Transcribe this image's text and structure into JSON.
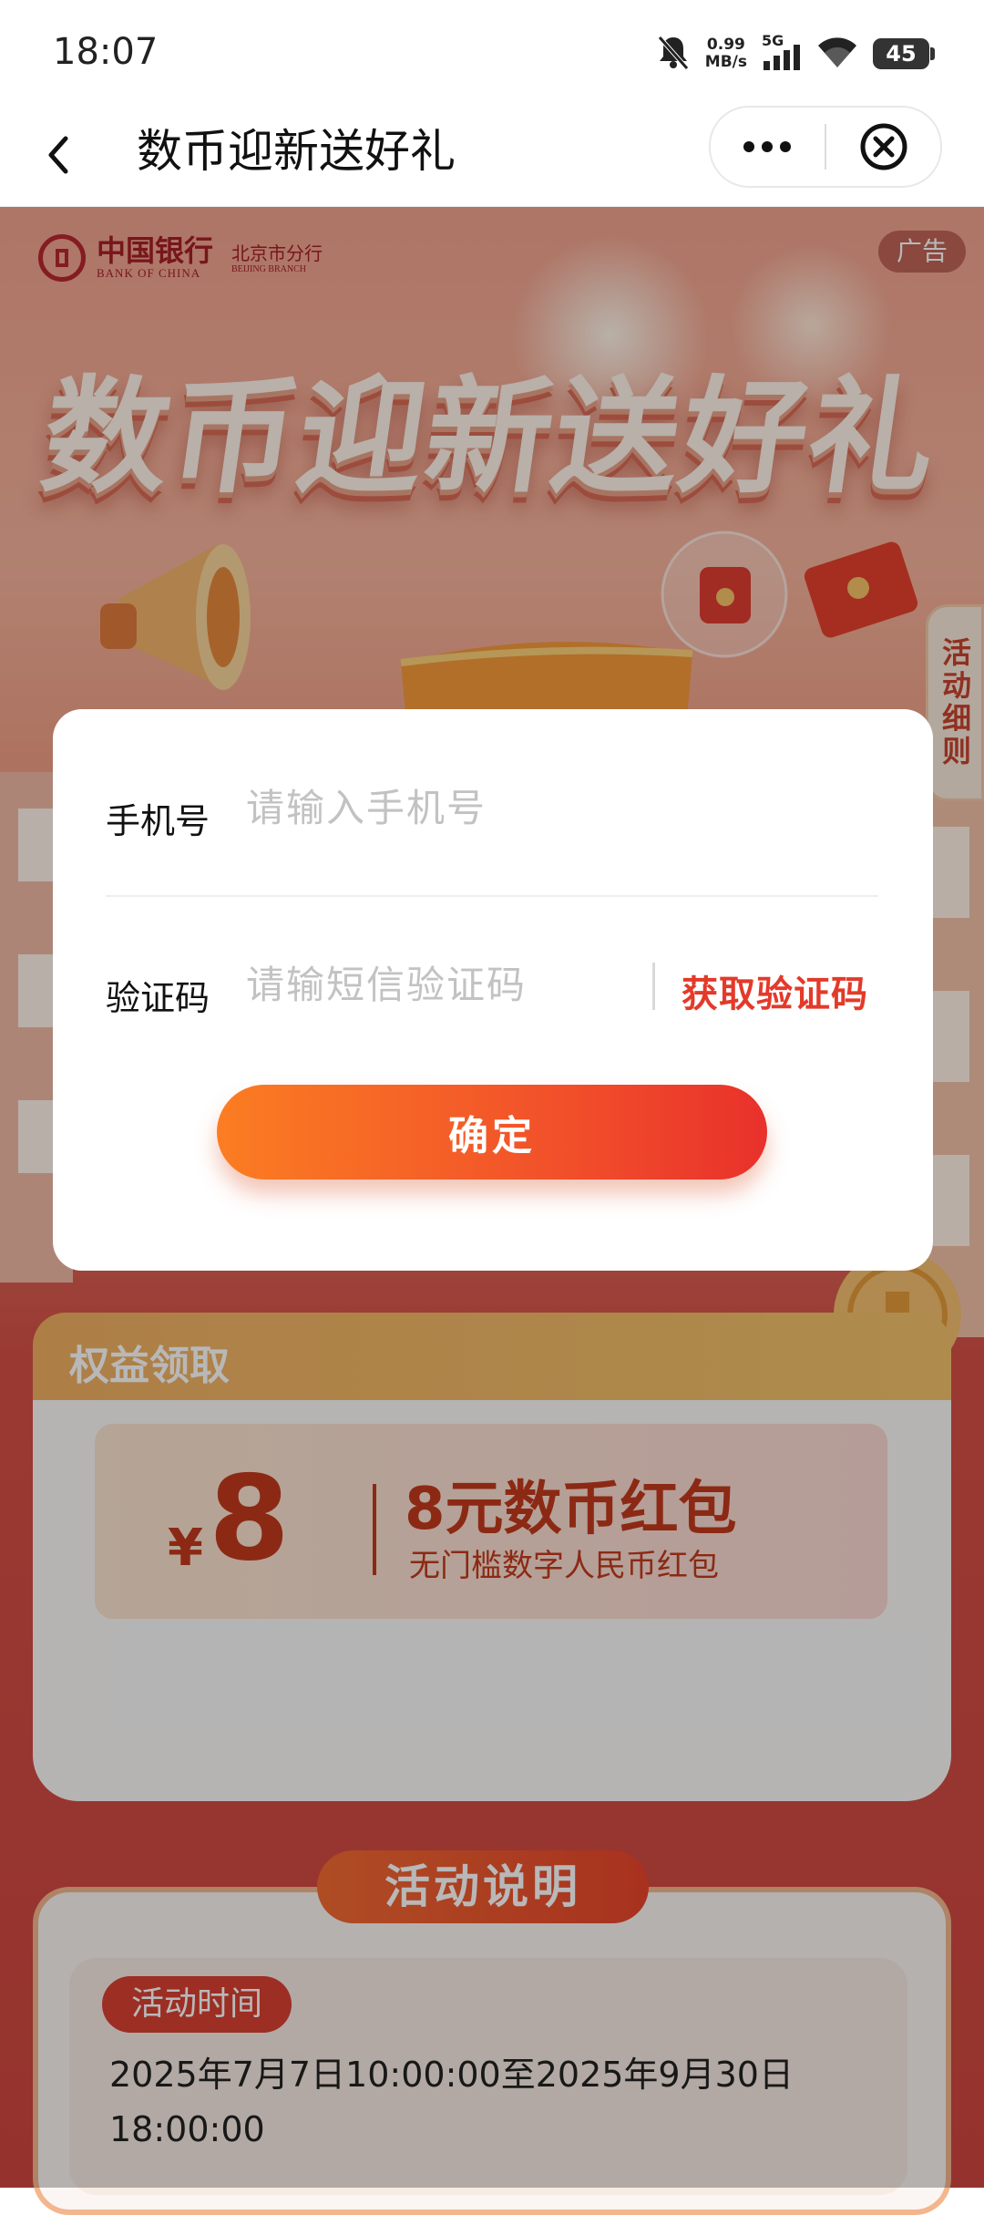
{
  "status_bar": {
    "time": "18:07",
    "net_speed_value": "0.99",
    "net_speed_unit": "MB/s",
    "network": "5G",
    "battery": "45",
    "icons": [
      "mute-bell-icon",
      "signal-icon",
      "wifi-icon",
      "battery-icon"
    ]
  },
  "nav": {
    "title": "数币迎新送好礼",
    "back_icon": "back-chevron-icon",
    "more_icon": "more-dots-icon",
    "close_icon": "close-circle-icon"
  },
  "banner": {
    "bank_name_cn": "中国银行",
    "bank_name_en": "BANK OF CHINA",
    "branch_cn": "北京市分行",
    "branch_en": "BEIJING BRANCH",
    "ad_label": "广告",
    "hero_title": "数币迎新送好礼",
    "side_tab": "活动细则"
  },
  "modal": {
    "phone_label": "手机号",
    "phone_placeholder": "请输入手机号",
    "phone_value": "",
    "code_label": "验证码",
    "code_placeholder": "请输短信验证码",
    "code_value": "",
    "get_code_label": "获取验证码",
    "confirm_label": "确定"
  },
  "benefits": {
    "title": "权益领取",
    "coupon": {
      "currency": "¥",
      "amount": "8",
      "title": "8元数币红包",
      "subtitle": "无门槛数字人民币红包"
    }
  },
  "activity": {
    "title": "活动说明",
    "time_badge": "活动时间",
    "time_text": "2025年7月7日10:00:00至2025年9月30日18:00:00"
  },
  "colors": {
    "accent": "#e33a2a",
    "button_start": "#fb7d22",
    "button_end": "#e8312b",
    "bank_red": "#a51f27"
  }
}
